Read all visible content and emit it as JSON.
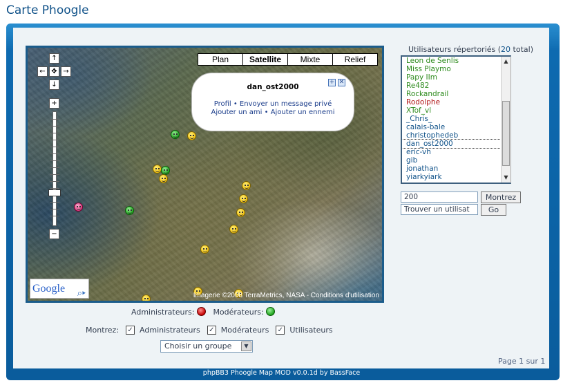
{
  "page": {
    "title": "Carte Phoogle"
  },
  "map": {
    "type_buttons": [
      "Plan",
      "Satellite",
      "Mixte",
      "Relief"
    ],
    "active_type": "Satellite",
    "attribution": "Imagerie ©2008 TerraMetrics, NASA - Conditions d'utilisation",
    "logo_text": "Google",
    "info_window": {
      "title": "dan_ost2000",
      "links_line1": "Profil • Envoyer un message privé",
      "links_line2": "Ajouter un ami • Ajouter un ennemi"
    },
    "zoom_level": 7
  },
  "legend": {
    "admins_label": "Administrateurs:",
    "mods_label": "Modérateurs:"
  },
  "filters": {
    "show_label": "Montrez:",
    "admins": "Administrateurs",
    "mods": "Modérateurs",
    "users": "Utilisateurs"
  },
  "group_select": {
    "value": "Choisir un groupe"
  },
  "pagination": {
    "text": "Page 1 sur 1"
  },
  "users_panel": {
    "heading_prefix": "Utilisateurs répertoriés (",
    "count": "20",
    "heading_suffix": " total)",
    "users": [
      {
        "name": "Leon de Senlis",
        "color": "#2e8b1e"
      },
      {
        "name": "Miss Playmo",
        "color": "#2e8b1e"
      },
      {
        "name": "Papy IIm",
        "color": "#2e8b1e"
      },
      {
        "name": "Re482",
        "color": "#2e8b1e"
      },
      {
        "name": "Rockandrail",
        "color": "#2e8b1e"
      },
      {
        "name": "Rodolphe",
        "color": "#b01616"
      },
      {
        "name": "XTof_vl",
        "color": "#2e8b1e"
      },
      {
        "name": "_Chris_",
        "color": "#105289"
      },
      {
        "name": "calais-bale",
        "color": "#105289"
      },
      {
        "name": "christophedeb",
        "color": "#105289"
      },
      {
        "name": "dan_ost2000",
        "color": "#105289"
      },
      {
        "name": "eric-vh",
        "color": "#105289"
      },
      {
        "name": "gib",
        "color": "#105289"
      },
      {
        "name": "jonathan",
        "color": "#105289"
      },
      {
        "name": "yiarkyiark",
        "color": "#105289"
      }
    ],
    "limit_value": "200",
    "show_button": "Montrez",
    "find_value": "Trouver un utilisat",
    "go_button": "Go"
  },
  "footer": {
    "text": "phpBB3 Phoogle Map MOD v0.0.1d by BassFace"
  }
}
